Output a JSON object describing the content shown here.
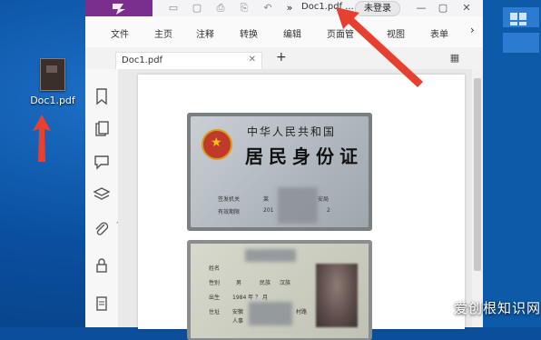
{
  "desktop": {
    "icon_label": "Doc1.pdf"
  },
  "titlebar": {
    "doc_title": "Doc1.pdf ...",
    "login_label": "未登录"
  },
  "menu": {
    "items": [
      "文件",
      "主页",
      "注释",
      "转换",
      "编辑",
      "页面管",
      "视图",
      "表单"
    ]
  },
  "tabs": {
    "active_label": "Doc1.pdf"
  },
  "id_card": {
    "title_small": "中华人民共和国",
    "title_big": "居民身份证",
    "field_authority": "签发机关",
    "field_validity": "有效期限",
    "authority_fragment": "莱",
    "authority_suffix": "安局",
    "validity_fragment": "201",
    "validity_suffix": "2"
  },
  "id_back": {
    "field_name": "姓名",
    "field_gender": "性别",
    "field_ethnicity": "民族",
    "field_birth": "出生",
    "field_address": "住址",
    "gender_fragment": "男",
    "ethnicity_fragment": "汉族",
    "birth_fragment": "1984 年 ？ 月",
    "address_fragment": "安徽",
    "address_fragment2": "人事",
    "address_suffix": "村路"
  },
  "watermark": "爱创根知识网",
  "colors": {
    "brand": "#7a2f8f",
    "arrow": "#e8402f",
    "desktop": "#0a4f9f"
  }
}
